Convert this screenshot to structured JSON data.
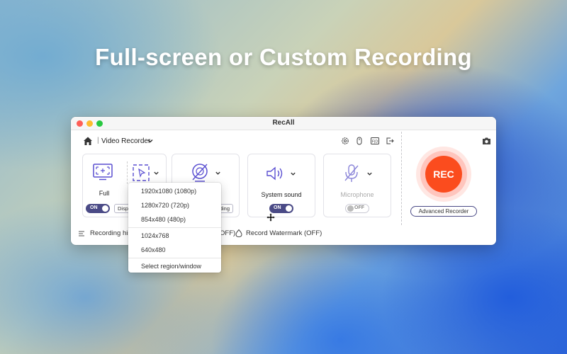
{
  "headline": "Full-screen or Custom Recording",
  "window": {
    "title": "RecAll"
  },
  "toolbar": {
    "separator": "|",
    "mode_label": "Video Recorder",
    "icons": [
      "settings-icon",
      "mouse-icon",
      "fps-icon",
      "exit-icon"
    ],
    "fps_text": "F|D"
  },
  "cards": {
    "display": {
      "label": "Full",
      "toggle": "ON",
      "button": "Display"
    },
    "webcam": {
      "button": "Recording"
    },
    "system_sound": {
      "label": "System sound",
      "toggle": "ON"
    },
    "microphone": {
      "label": "Microphone",
      "toggle": "OFF"
    }
  },
  "rec": {
    "label": "REC",
    "advanced": "Advanced Recorder"
  },
  "bottom": {
    "history": "Recording his",
    "history_tail": "OFF)",
    "watermark": "Record Watermark (OFF)"
  },
  "dropdown": {
    "items": [
      "1920x1080 (1080p)",
      "1280x720 (720p)",
      "854x480 (480p)",
      "1024x768",
      "640x480",
      "Select region/window"
    ]
  },
  "colors": {
    "accent": "#4a4a86",
    "rec": "#fb4c1e",
    "icon": "#5a4fd1"
  }
}
